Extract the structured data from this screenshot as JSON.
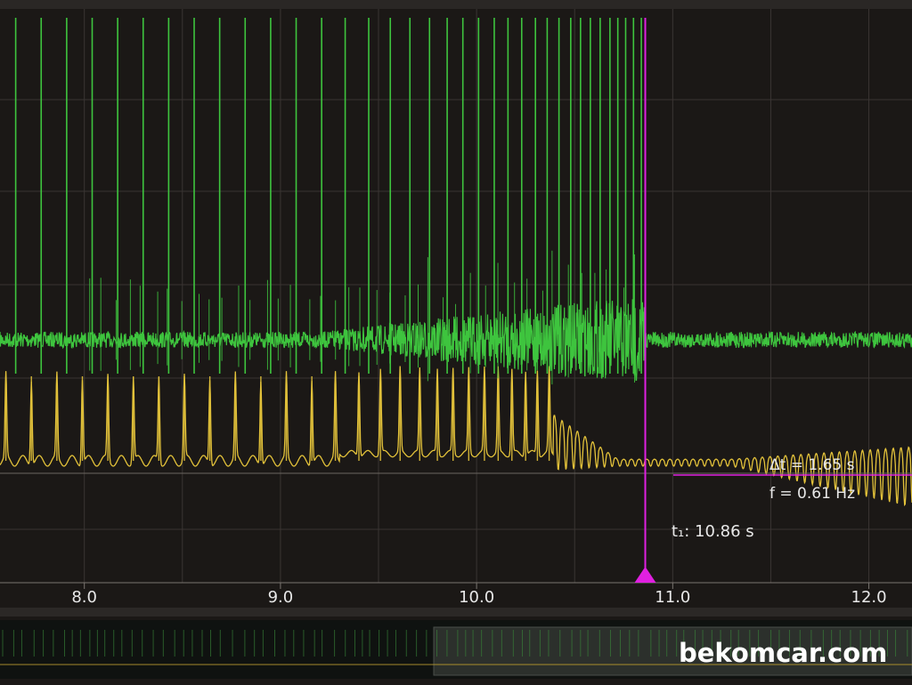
{
  "chart_data": {
    "type": "line",
    "title": "",
    "xlabel": "",
    "ylabel": "",
    "xlim": [
      7.57,
      12.22
    ],
    "x_ticks": [
      "8.0",
      "9.0",
      "10.0",
      "11.0",
      "12.0"
    ],
    "grid": true,
    "series": [
      {
        "color": "#3ec43e",
        "baseline_level": 0.5,
        "spike_times": [
          7.65,
          7.78,
          7.91,
          8.04,
          8.17,
          8.3,
          8.43,
          8.56,
          8.69,
          8.82,
          8.95,
          9.08,
          9.21,
          9.33,
          9.45,
          9.56,
          9.66,
          9.76,
          9.85,
          9.93,
          10.01,
          10.09,
          10.16,
          10.23,
          10.3,
          10.36,
          10.42,
          10.48,
          10.53,
          10.58,
          10.63,
          10.68,
          10.72,
          10.76,
          10.8,
          10.84
        ],
        "ends_at": 10.86
      },
      {
        "color": "#e3c23a",
        "baseline_level": 0.0,
        "peak_times": [
          7.6,
          7.73,
          7.86,
          7.99,
          8.12,
          8.25,
          8.38,
          8.51,
          8.64,
          8.77,
          8.9,
          9.03,
          9.16,
          9.28,
          9.4,
          9.51,
          9.61,
          9.71,
          9.8,
          9.88,
          9.96,
          10.04,
          10.11,
          10.18,
          10.25,
          10.31,
          10.37
        ],
        "decay_after": 10.37,
        "ramp_peaks_from": 11.3
      }
    ],
    "cursor": {
      "time": 10.86,
      "time_label": "t₁: 10.86 s",
      "delta_label": "Δt = 1.65 s",
      "freq_label": "f = 0.61 Hz",
      "color": "#e020e0"
    }
  },
  "watermark": "bekomcar.com",
  "colors": {
    "background": "#1b1816",
    "grid": "#3a3533",
    "green": "#3ec43e",
    "yellow": "#e3c23a",
    "cursor": "#e020e0"
  }
}
